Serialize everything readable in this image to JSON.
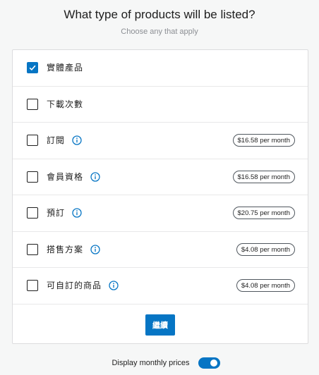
{
  "header": {
    "title": "What type of products will be listed?",
    "subtitle": "Choose any that apply"
  },
  "options": [
    {
      "label": "實體產品",
      "checked": true,
      "has_info": false,
      "price": ""
    },
    {
      "label": "下載次數",
      "checked": false,
      "has_info": false,
      "price": ""
    },
    {
      "label": "訂閱",
      "checked": false,
      "has_info": true,
      "price": "$16.58 per month"
    },
    {
      "label": "會員資格",
      "checked": false,
      "has_info": true,
      "price": "$16.58 per month"
    },
    {
      "label": "預訂",
      "checked": false,
      "has_info": true,
      "price": "$20.75 per month"
    },
    {
      "label": "搭售方案",
      "checked": false,
      "has_info": true,
      "price": "$4.08 per month"
    },
    {
      "label": "可自訂的商品",
      "checked": false,
      "has_info": true,
      "price": "$4.08 per month"
    }
  ],
  "continue_label": "繼續",
  "toggle": {
    "label": "Display monthly prices",
    "on": true
  },
  "colors": {
    "accent": "#0675c4",
    "background": "#f6f7f7",
    "card": "#ffffff",
    "text": "#1e1e1e",
    "muted": "#8c8f94"
  },
  "icons": {
    "check": "checkmark-icon",
    "info": "info-icon"
  }
}
